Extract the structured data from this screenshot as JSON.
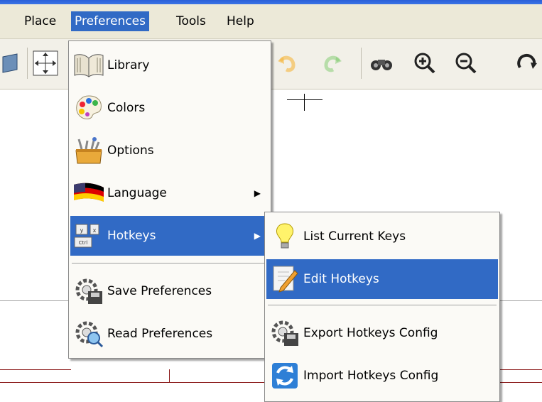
{
  "menubar": {
    "items": [
      {
        "label": "Place"
      },
      {
        "label": "Preferences"
      },
      {
        "label": "Tools"
      },
      {
        "label": "Help"
      }
    ]
  },
  "toolbar": {
    "icons": [
      "page-icon",
      "page-size-icon",
      "undo-icon",
      "redo-icon",
      "find-icon",
      "zoom-in-icon",
      "zoom-out-icon",
      "redraw-icon"
    ]
  },
  "preferences_menu": {
    "items": [
      {
        "label": "Library",
        "icon": "library-icon"
      },
      {
        "label": "Colors",
        "icon": "colors-icon"
      },
      {
        "label": "Options",
        "icon": "options-icon"
      },
      {
        "label": "Language",
        "icon": "language-icon",
        "submenu": true
      },
      {
        "label": "Hotkeys",
        "icon": "hotkeys-icon",
        "submenu": true,
        "highlighted": true
      },
      {
        "label": "Save Preferences",
        "icon": "save-preferences-icon"
      },
      {
        "label": "Read Preferences",
        "icon": "read-preferences-icon"
      }
    ],
    "hotkey_icon_keys": [
      "y",
      "x",
      "Ctrl"
    ]
  },
  "hotkeys_submenu": {
    "items": [
      {
        "label": "List Current Keys",
        "icon": "lightbulb-icon"
      },
      {
        "label": "Edit Hotkeys",
        "icon": "edit-icon",
        "highlighted": true
      },
      {
        "label": "Export Hotkeys Config",
        "icon": "export-icon"
      },
      {
        "label": "Import Hotkeys Config",
        "icon": "import-icon"
      }
    ]
  },
  "colors": {
    "highlight": "#316ac5",
    "menubar": "#ece9d8",
    "menu_bg": "#fbfaf6",
    "schematic_line": "#8b1a1a"
  }
}
